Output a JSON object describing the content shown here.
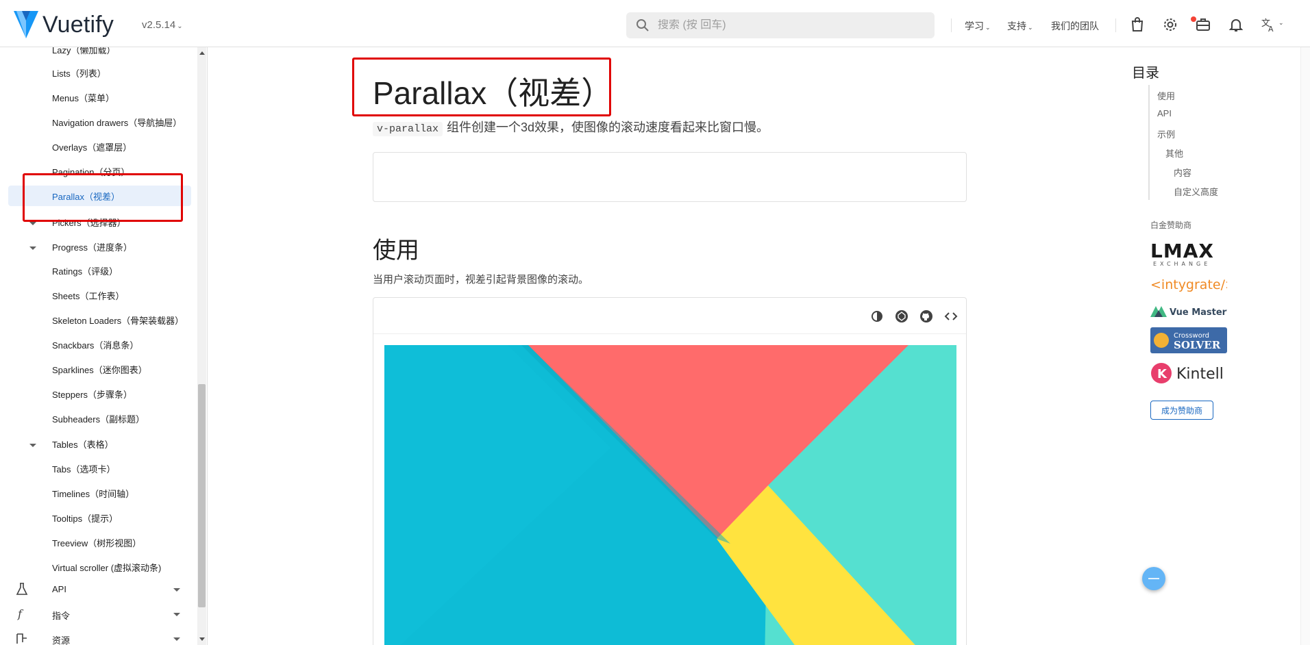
{
  "header": {
    "brand": "Vuetify",
    "version": "v2.5.14",
    "search_placeholder": "搜索 (按 回车)",
    "nav": [
      "学习",
      "支持",
      "我们的团队"
    ]
  },
  "sidebar": {
    "items": [
      {
        "label": "Lazy（懒加载）"
      },
      {
        "label": "Lists（列表）"
      },
      {
        "label": "Menus（菜单）"
      },
      {
        "label": "Navigation drawers（导航抽屉）"
      },
      {
        "label": "Overlays（遮罩层）"
      },
      {
        "label": "Pagination（分页）"
      },
      {
        "label": "Parallax（视差）",
        "active": true
      },
      {
        "label": "Pickers（选择器）"
      },
      {
        "label": "Progress（进度条）"
      },
      {
        "label": "Ratings（评级）"
      },
      {
        "label": "Sheets（工作表）"
      },
      {
        "label": "Skeleton Loaders（骨架装载器）"
      },
      {
        "label": "Snackbars（消息条）"
      },
      {
        "label": "Sparklines（迷你图表）"
      },
      {
        "label": "Steppers（步骤条）"
      },
      {
        "label": "Subheaders（副标题）"
      },
      {
        "label": "Tables（表格）"
      },
      {
        "label": "Tabs（选项卡）"
      },
      {
        "label": "Timelines（时间轴）"
      },
      {
        "label": "Tooltips（提示）"
      },
      {
        "label": "Treeview（树形视图）"
      },
      {
        "label": "Virtual scroller (虚拟滚动条)"
      }
    ],
    "groups": [
      {
        "label": "API",
        "icon": "flask-icon"
      },
      {
        "label": "指令",
        "icon": "function-icon"
      },
      {
        "label": "资源",
        "icon": "resources-icon"
      }
    ]
  },
  "main": {
    "title": "Parallax（视差）",
    "description_code": "v-parallax",
    "description_text": "组件创建一个3d效果，使图像的滚动速度看起来比窗口慢。",
    "usage_heading": "使用",
    "usage_text": "当用户滚动页面时，视差引起背景图像的滚动。",
    "example_icons": [
      "invert-colors-icon",
      "codepen-icon",
      "github-icon",
      "code-icon"
    ],
    "parallax_colors": {
      "cyan": "#0ebcd6",
      "coral": "#ff6b6b",
      "teal": "#55e0d0",
      "yellow": "#ffe33f"
    }
  },
  "toc": {
    "title": "目录",
    "items": [
      {
        "label": "使用",
        "level": 0
      },
      {
        "label": "API",
        "level": 0
      },
      {
        "label": "示例",
        "level": 0
      },
      {
        "label": "其他",
        "level": 1
      },
      {
        "label": "内容",
        "level": 2
      },
      {
        "label": "自定义高度",
        "level": 2
      }
    ],
    "sponsor_label": "白金赞助商",
    "sponsors": [
      "LMAX",
      "EXCHANGE",
      "<intygrate/>",
      "Vue Mastery",
      "Crossword",
      "SOLVER",
      "Kintell"
    ],
    "become_sponsor": "成为赞助商"
  },
  "colors": {
    "accent": "#1867c0",
    "annotation": "#e00000"
  }
}
